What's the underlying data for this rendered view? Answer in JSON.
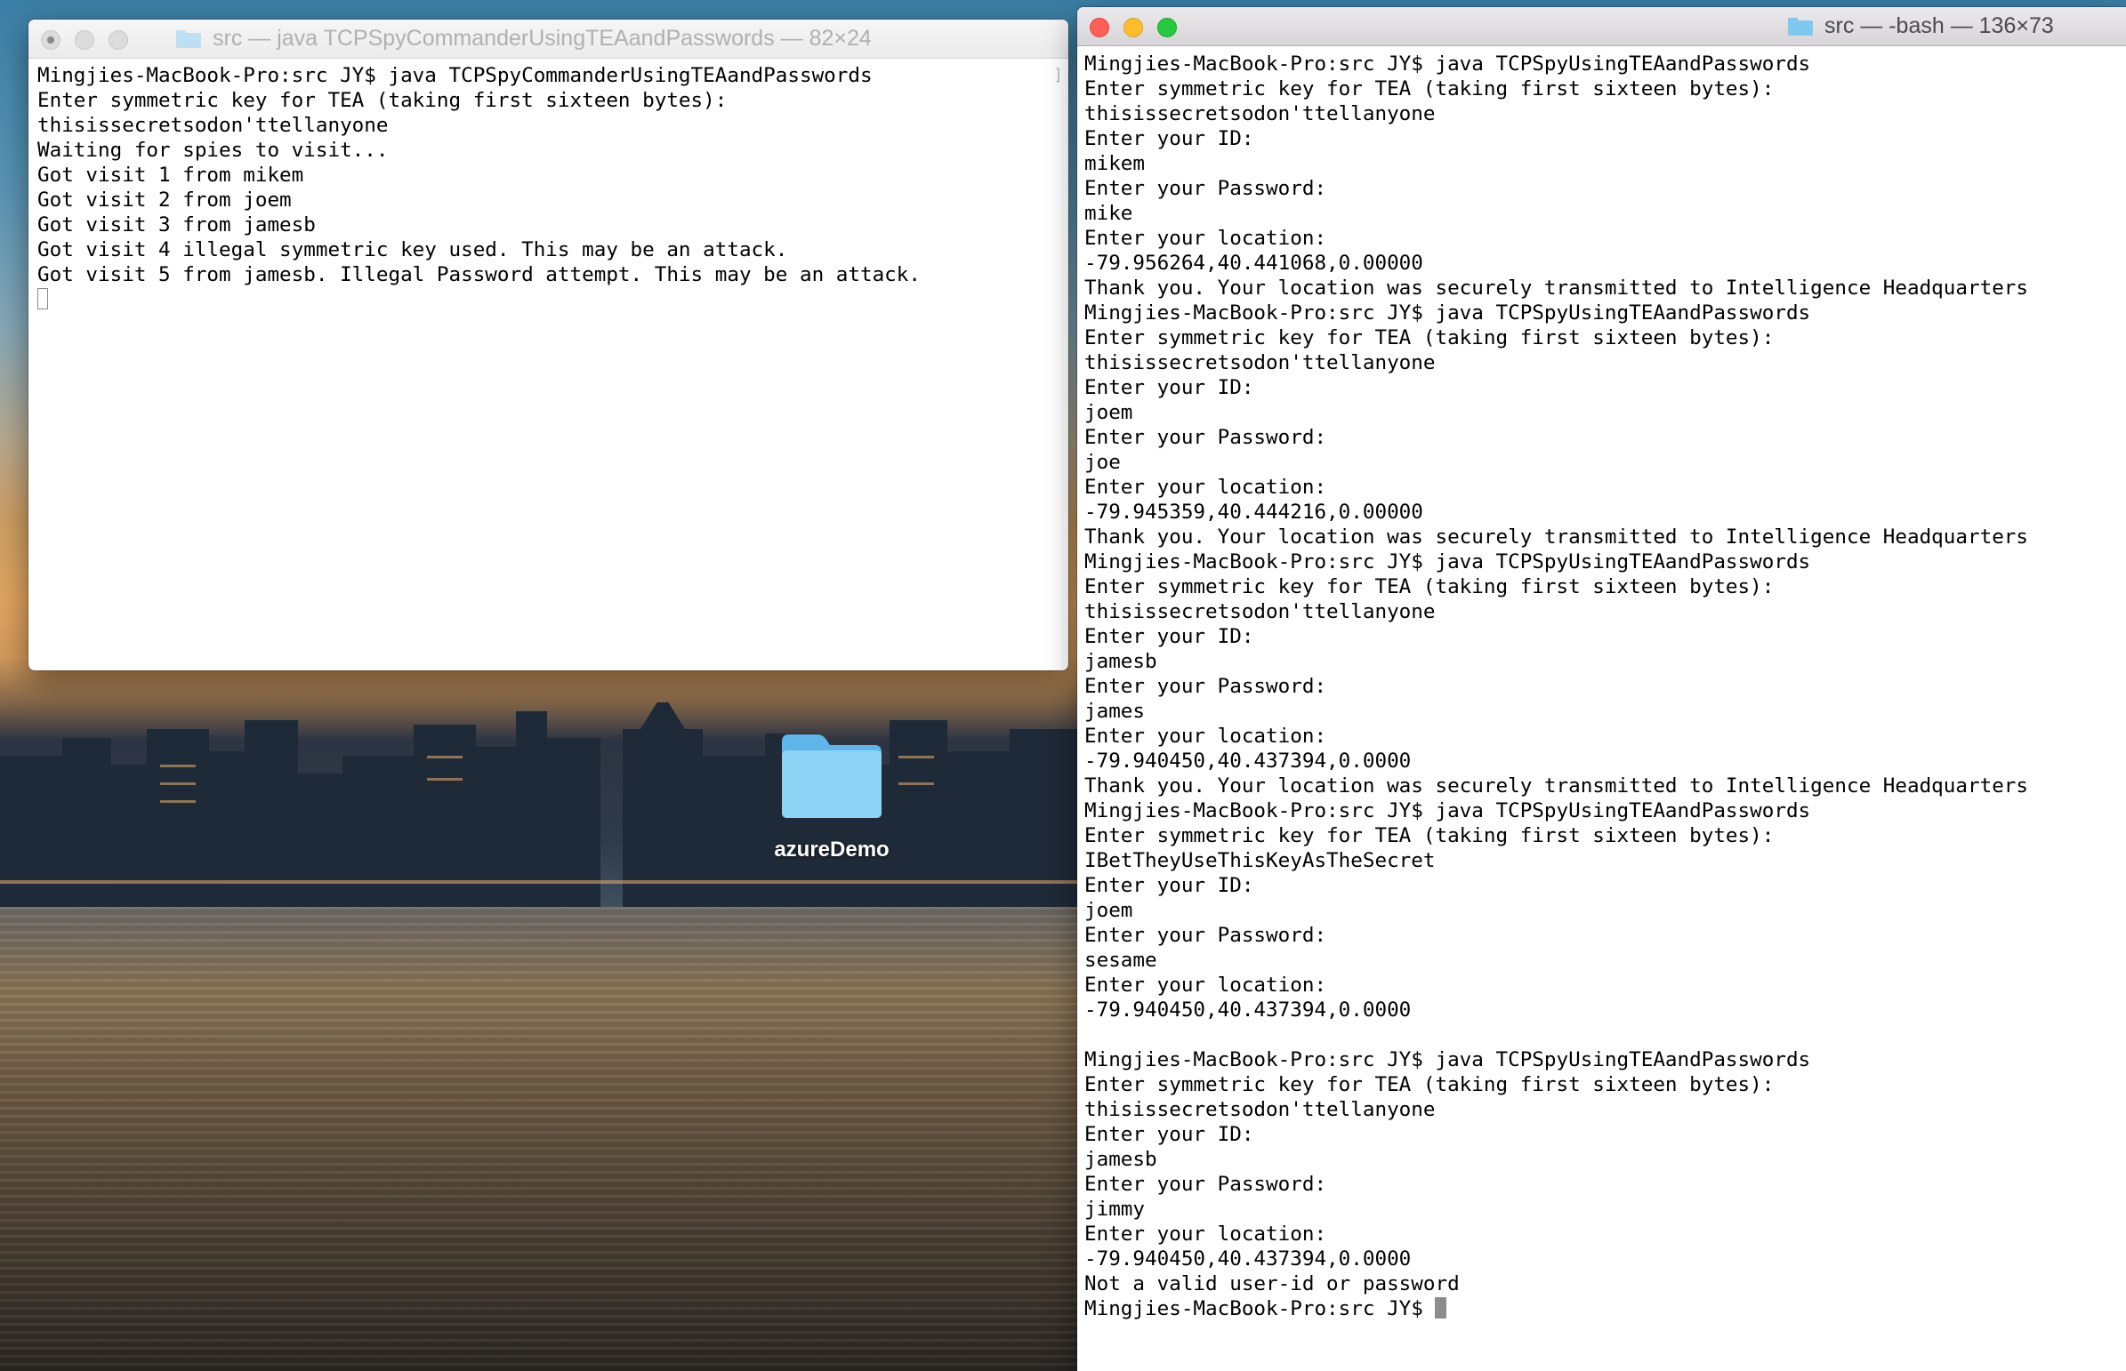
{
  "desktop": {
    "folder_label": "azureDemo"
  },
  "left_terminal": {
    "title": "src — java TCPSpyCommanderUsingTEAandPasswords — 82×24",
    "lines": [
      "Mingjies-MacBook-Pro:src JY$ java TCPSpyCommanderUsingTEAandPasswords",
      "Enter symmetric key for TEA (taking first sixteen bytes):",
      "thisissecretsodon'ttellanyone",
      "Waiting for spies to visit...",
      "Got visit 1 from mikem",
      "Got visit 2 from joem",
      "Got visit 3 from jamesb",
      "Got visit 4 illegal symmetric key used. This may be an attack.",
      "Got visit 5 from jamesb. Illegal Password attempt. This may be an attack."
    ]
  },
  "right_terminal": {
    "title": "src — -bash — 136×73",
    "lines": [
      "Mingjies-MacBook-Pro:src JY$ java TCPSpyUsingTEAandPasswords",
      "Enter symmetric key for TEA (taking first sixteen bytes):",
      "thisissecretsodon'ttellanyone",
      "Enter your ID:",
      "mikem",
      "Enter your Password:",
      "mike",
      "Enter your location:",
      "-79.956264,40.441068,0.00000",
      "Thank you. Your location was securely transmitted to Intelligence Headquarters",
      "Mingjies-MacBook-Pro:src JY$ java TCPSpyUsingTEAandPasswords",
      "Enter symmetric key for TEA (taking first sixteen bytes):",
      "thisissecretsodon'ttellanyone",
      "Enter your ID:",
      "joem",
      "Enter your Password:",
      "joe",
      "Enter your location:",
      "-79.945359,40.444216,0.00000",
      "Thank you. Your location was securely transmitted to Intelligence Headquarters",
      "Mingjies-MacBook-Pro:src JY$ java TCPSpyUsingTEAandPasswords",
      "Enter symmetric key for TEA (taking first sixteen bytes):",
      "thisissecretsodon'ttellanyone",
      "Enter your ID:",
      "jamesb",
      "Enter your Password:",
      "james",
      "Enter your location:",
      "-79.940450,40.437394,0.0000",
      "Thank you. Your location was securely transmitted to Intelligence Headquarters",
      "Mingjies-MacBook-Pro:src JY$ java TCPSpyUsingTEAandPasswords",
      "Enter symmetric key for TEA (taking first sixteen bytes):",
      "IBetTheyUseThisKeyAsTheSecret",
      "Enter your ID:",
      "joem",
      "Enter your Password:",
      "sesame",
      "Enter your location:",
      "-79.940450,40.437394,0.0000",
      "",
      "Mingjies-MacBook-Pro:src JY$ java TCPSpyUsingTEAandPasswords",
      "Enter symmetric key for TEA (taking first sixteen bytes):",
      "thisissecretsodon'ttellanyone",
      "Enter your ID:",
      "jamesb",
      "Enter your Password:",
      "jimmy",
      "Enter your location:",
      "-79.940450,40.437394,0.0000",
      "Not a valid user-id or password"
    ],
    "prompt": "Mingjies-MacBook-Pro:src JY$ "
  },
  "icons": {
    "window_folder": "folder-icon",
    "desktop_folder": "folder-icon"
  },
  "colors": {
    "traffic_red": "#fe5f57",
    "traffic_yellow": "#febc2e",
    "traffic_green": "#28c840",
    "folder_blue": "#7fc8f0"
  }
}
